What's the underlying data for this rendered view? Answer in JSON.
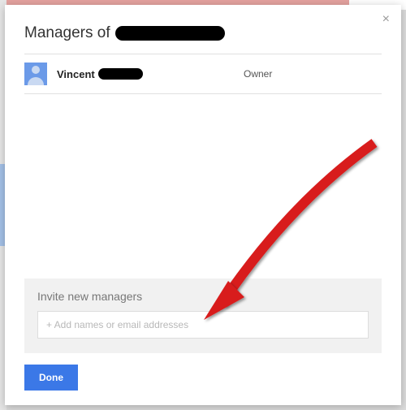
{
  "dialog": {
    "title_prefix": "Managers of",
    "close_glyph": "×"
  },
  "members": [
    {
      "name_visible": "Vincent",
      "role": "Owner"
    }
  ],
  "invite": {
    "heading": "Invite new managers",
    "placeholder": "+ Add names or email addresses"
  },
  "actions": {
    "done_label": "Done"
  }
}
